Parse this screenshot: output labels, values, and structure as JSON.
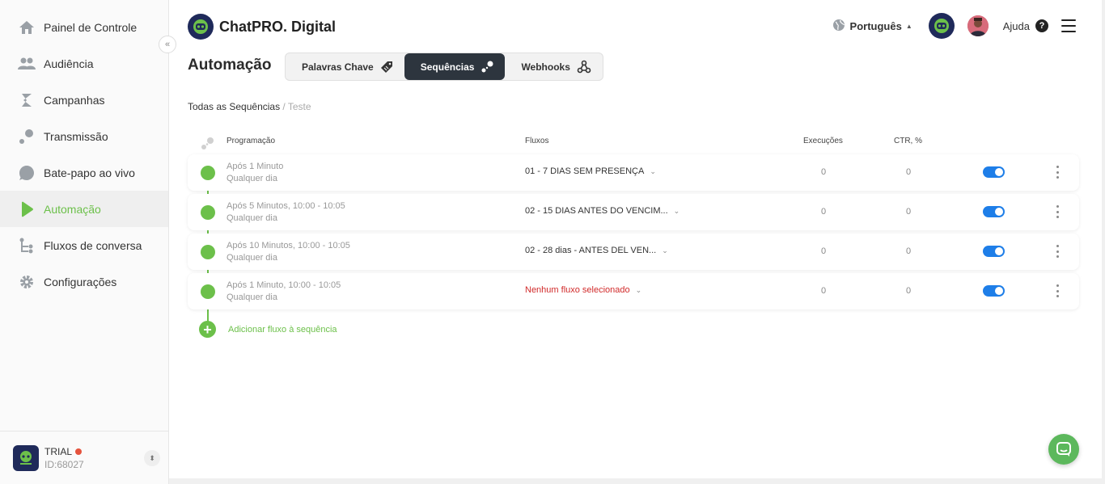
{
  "sidebar": {
    "items": [
      {
        "label": "Painel de Controle",
        "icon": "home-icon"
      },
      {
        "label": "Audiência",
        "icon": "users-icon"
      },
      {
        "label": "Campanhas",
        "icon": "campaign-icon"
      },
      {
        "label": "Transmissão",
        "icon": "broadcast-icon"
      },
      {
        "label": "Bate-papo ao vivo",
        "icon": "chat-bubble-icon"
      },
      {
        "label": "Automação",
        "icon": "play-icon",
        "active": true
      },
      {
        "label": "Fluxos de conversa",
        "icon": "flow-icon"
      },
      {
        "label": "Configurações",
        "icon": "gear-icon"
      }
    ],
    "account": {
      "plan": "TRIAL",
      "id": "ID:68027"
    }
  },
  "header": {
    "brand": "ChatPRO. Digital",
    "language": "Português",
    "help": "Ajuda"
  },
  "page": {
    "title": "Automação",
    "tabs": [
      {
        "label": "Palavras Chave",
        "icon": "tag-icon"
      },
      {
        "label": "Sequências",
        "icon": "sequence-icon",
        "active": true
      },
      {
        "label": "Webhooks",
        "icon": "webhook-icon"
      }
    ],
    "breadcrumb": {
      "root": "Todas as Sequências",
      "sep": " / ",
      "current": "Teste"
    }
  },
  "table": {
    "headers": {
      "schedule": "Programação",
      "flows": "Fluxos",
      "executions": "Execuções",
      "ctr": "CTR, %"
    },
    "rows": [
      {
        "schedule": "Após 1 Minuto",
        "days": "Qualquer dia",
        "flow": "01 - 7 DIAS SEM PRESENÇA",
        "executions": "0",
        "ctr": "0",
        "enabled": true
      },
      {
        "schedule": "Após 5 Minutos, 10:00 - 10:05",
        "days": "Qualquer dia",
        "flow": "02 - 15 DIAS ANTES DO VENCIM...",
        "executions": "0",
        "ctr": "0",
        "enabled": true
      },
      {
        "schedule": "Após 10 Minutos, 10:00 - 10:05",
        "days": "Qualquer dia",
        "flow": "02 - 28 dias - ANTES DEL VEN...",
        "executions": "0",
        "ctr": "0",
        "enabled": true
      },
      {
        "schedule": "Após 1 Minuto, 10:00 - 10:05",
        "days": "Qualquer dia",
        "flow": "Nenhum fluxo selecionado",
        "executions": "0",
        "ctr": "0",
        "enabled": true,
        "empty": true
      }
    ],
    "add_label": "Adicionar fluxo à sequência"
  },
  "colors": {
    "accent": "#6cc04a",
    "toggle": "#1e7ee8",
    "error": "#d12a2a",
    "dark": "#2d353e"
  }
}
